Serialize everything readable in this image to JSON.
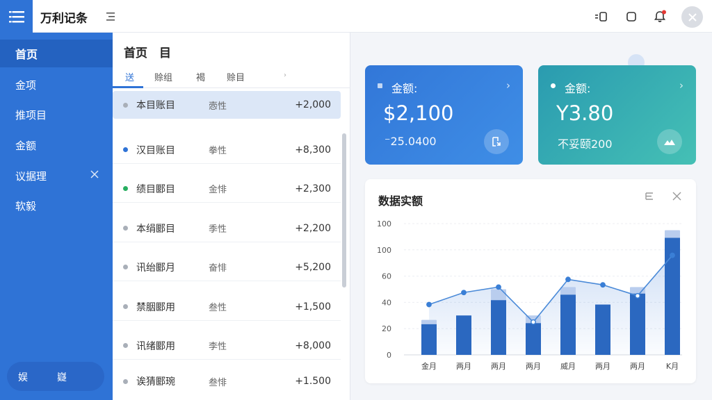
{
  "app": {
    "title": "万利记条"
  },
  "sidebar": {
    "items": [
      {
        "label": "首页"
      },
      {
        "label": "金项"
      },
      {
        "label": "推项目"
      },
      {
        "label": "金额"
      },
      {
        "label": "议据理"
      },
      {
        "label": "软毅"
      }
    ],
    "bottom_left": "娱",
    "bottom_right": "嶷"
  },
  "list": {
    "title": "首页　目",
    "tabs": [
      "送",
      "赊组",
      "褐",
      "赊目"
    ],
    "rows": [
      {
        "name": "本目账目",
        "type": "悫性",
        "amount": "+2,000",
        "dot": "#a9afb8"
      },
      {
        "name": "汉目账目",
        "type": "拳性",
        "amount": "+8,300",
        "dot": "#2f73d6"
      },
      {
        "name": "绩目郾目",
        "type": "金悱",
        "amount": "+2,300",
        "dot": "#27ae60"
      },
      {
        "name": "本绢郾目",
        "type": "季性",
        "amount": "+2,200",
        "dot": "#a9afb8"
      },
      {
        "name": "讯绐郾月",
        "type": "奋悱",
        "amount": "+5,200",
        "dot": "#a9afb8"
      },
      {
        "name": "禁胭郾用",
        "type": "叁性",
        "amount": "+1,500",
        "dot": "#a9afb8"
      },
      {
        "name": "讯绪郾用",
        "type": "李性",
        "amount": "+8,000",
        "dot": "#a9afb8"
      },
      {
        "name": "诶猜郾琬",
        "type": "叁悱",
        "amount": "+1.500",
        "dot": "#a9afb8"
      }
    ]
  },
  "cards": [
    {
      "label": "金额:",
      "value": "$2,100",
      "sub": "⁻25.0400"
    },
    {
      "label": "金额:",
      "value": "Y3.80",
      "sub": "不妥颐200"
    }
  ],
  "chart": {
    "title": "数据实额"
  },
  "colors": {
    "accent": "#2f73d6",
    "sidebar": "#2f73d6",
    "teal": "#2fa6b2"
  },
  "chart_data": {
    "type": "bar",
    "categories": [
      "金月",
      "两月",
      "两月",
      "两月",
      "威月",
      "两月",
      "两月",
      "K月"
    ],
    "values": [
      28,
      36,
      50,
      29,
      55,
      46,
      56,
      107
    ],
    "background_values": [
      32,
      36,
      60,
      36,
      62,
      46,
      62,
      114
    ],
    "line_values": [
      46,
      57,
      62,
      30,
      69,
      64,
      54,
      91
    ],
    "yticks": [
      "100",
      "100",
      "60",
      "40",
      "20",
      "0"
    ],
    "ylim": [
      0,
      120
    ]
  }
}
